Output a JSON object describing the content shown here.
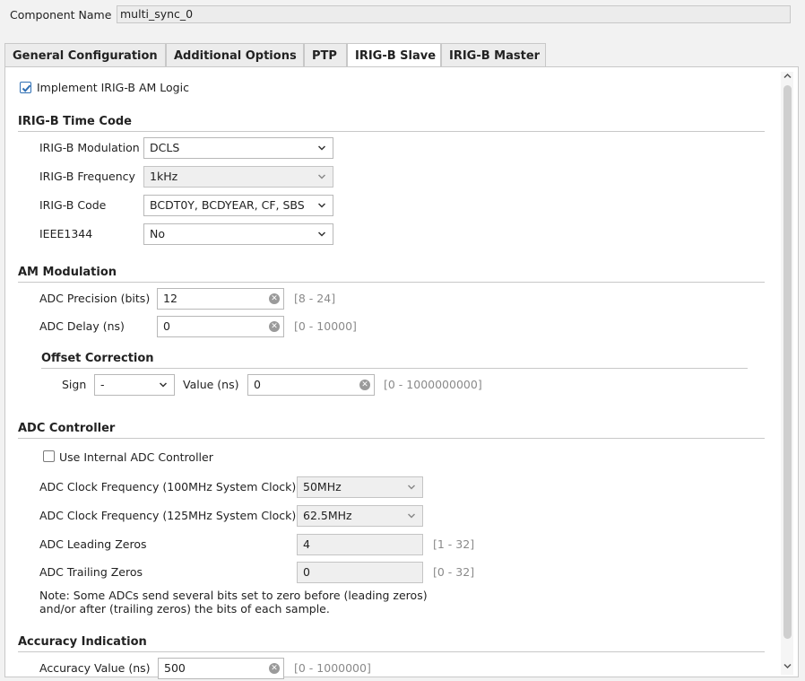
{
  "component": {
    "label": "Component Name",
    "value": "multi_sync_0"
  },
  "tabs": [
    {
      "label": "General Configuration"
    },
    {
      "label": "Additional Options"
    },
    {
      "label": "PTP"
    },
    {
      "label": "IRIG-B Slave"
    },
    {
      "label": "IRIG-B Master"
    }
  ],
  "active_tab": "IRIG-B Slave",
  "implement_am": {
    "label": "Implement IRIG-B AM Logic",
    "checked": true
  },
  "timecode": {
    "heading": "IRIG-B Time Code",
    "modulation": {
      "label": "IRIG-B Modulation",
      "value": "DCLS"
    },
    "frequency": {
      "label": "IRIG-B Frequency",
      "value": "1kHz"
    },
    "code": {
      "label": "IRIG-B Code",
      "value": "BCDT0Y, BCDYEAR, CF, SBS"
    },
    "ieee": {
      "label": "IEEE1344",
      "value": "No"
    }
  },
  "am": {
    "heading": "AM Modulation",
    "precision": {
      "label": "ADC Precision (bits)",
      "value": "12",
      "range": "[8 - 24]"
    },
    "delay": {
      "label": "ADC Delay (ns)",
      "value": "0",
      "range": "[0 - 10000]"
    },
    "offset": {
      "heading": "Offset Correction",
      "sign_label": "Sign",
      "sign_value": "-",
      "value_label": "Value (ns)",
      "value": "0",
      "range": "[0 - 1000000000]"
    }
  },
  "adc": {
    "heading": "ADC Controller",
    "internal": {
      "label": "Use Internal ADC Controller",
      "checked": false
    },
    "clk100": {
      "label": "ADC Clock Frequency (100MHz System Clock)",
      "value": "50MHz"
    },
    "clk125": {
      "label": "ADC Clock Frequency (125MHz System Clock)",
      "value": "62.5MHz"
    },
    "leading": {
      "label": "ADC Leading Zeros",
      "value": "4",
      "range": "[1 - 32]"
    },
    "trailing": {
      "label": "ADC Trailing Zeros",
      "value": "0",
      "range": "[0 - 32]"
    },
    "note_line1": "Note: Some ADCs send several bits set to zero before (leading zeros)",
    "note_line2": "and/or after (trailing zeros) the bits of each sample."
  },
  "accuracy": {
    "heading": "Accuracy Indication",
    "value_label": "Accuracy Value (ns)",
    "value": "500",
    "range": "[0 - 1000000]"
  },
  "icons": {
    "dropdown": "chevron-down-icon",
    "clear": "clear-icon",
    "check": "check-icon"
  },
  "colors": {
    "check_accent": "#2f6fb4"
  }
}
